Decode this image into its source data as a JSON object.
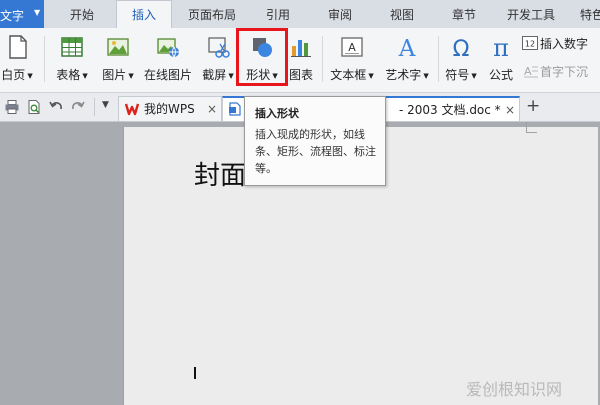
{
  "menubar": {
    "app_label": "文字",
    "tabs": [
      "开始",
      "插入",
      "页面布局",
      "引用",
      "审阅",
      "视图",
      "章节",
      "开发工具",
      "特色"
    ]
  },
  "ribbon": {
    "blank_page": "白页",
    "table": "表格",
    "picture": "图片",
    "online_picture": "在线图片",
    "screenshot": "截屏",
    "shape": "形状",
    "chart": "图表",
    "textbox": "文本框",
    "wordart": "艺术字",
    "symbol": "符号",
    "formula": "公式",
    "insert_number": "插入数字",
    "dropcap": "首字下沉"
  },
  "doc_tabs": {
    "tab1": "我的WPS",
    "tab2_suffix": "- 2003 文档.doc *",
    "close_glyph": "×",
    "add_glyph": "+"
  },
  "tooltip": {
    "title": "插入形状",
    "body": "插入现成的形状，如线条、矩形、流程图、标注等。"
  },
  "document": {
    "title_text": "封面"
  },
  "watermark": "爱创根知识网",
  "colors": {
    "accent": "#3478d4",
    "highlight_frame": "#e8151b",
    "wps_red": "#d9251d"
  }
}
